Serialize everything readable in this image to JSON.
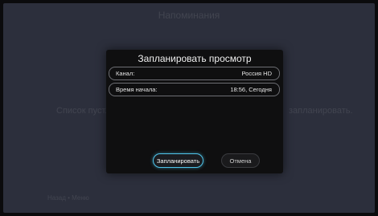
{
  "background": {
    "header_text": "Напоминания",
    "message_left": "Список пуст.",
    "message_right": "запланировать.",
    "hint": "Назад • Меню"
  },
  "dialog": {
    "title": "Запланировать просмотр",
    "rows": [
      {
        "label": "Канал:",
        "value": "Россия HD"
      },
      {
        "label": "Время начала:",
        "value": "18:56, Сегодня"
      }
    ],
    "buttons": {
      "schedule": "Запланировать",
      "cancel": "Отмена"
    }
  },
  "colors": {
    "backdrop": "#2c2f3c",
    "dialog_bg": "#0f0f10",
    "focus_accent": "#4fc3e8"
  }
}
